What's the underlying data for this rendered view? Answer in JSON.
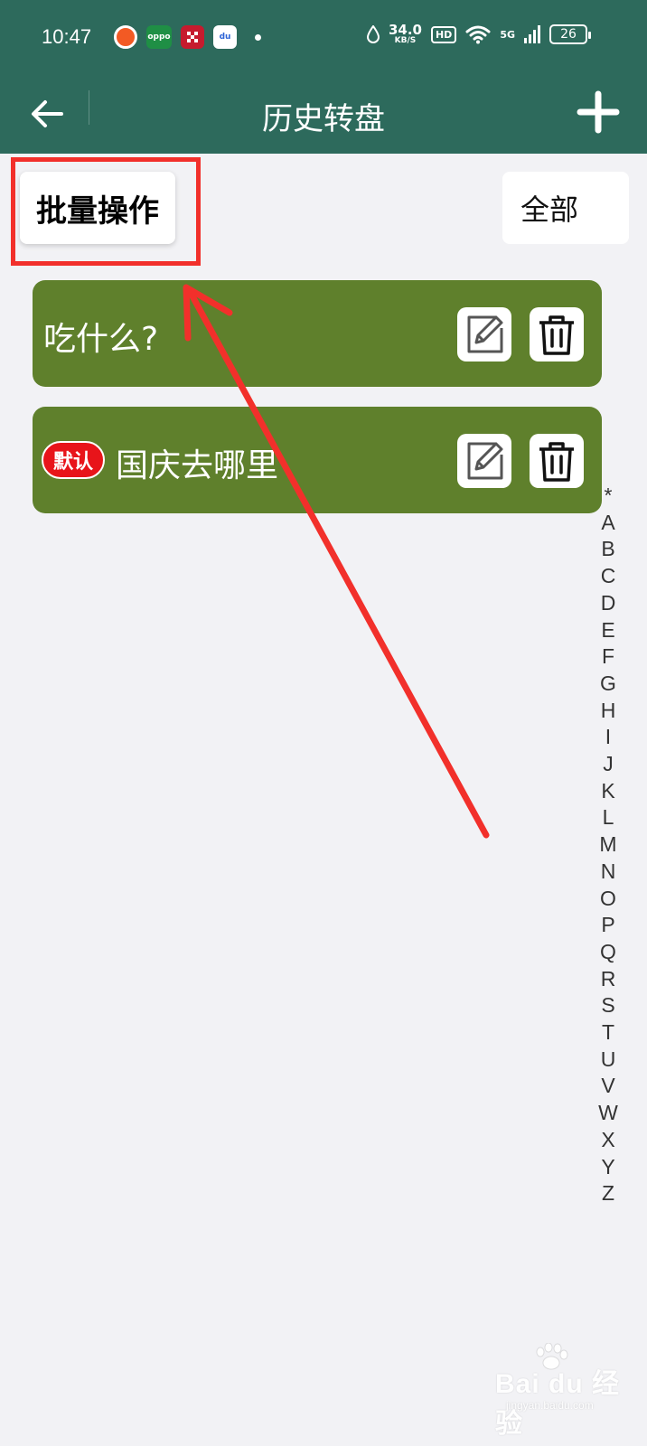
{
  "status_bar": {
    "time": "10:47",
    "notifications": [
      {
        "icon": "taobao-icon",
        "label": ""
      },
      {
        "icon": "oppo-icon",
        "label": "oppo"
      },
      {
        "icon": "checker-app-icon",
        "label": ""
      },
      {
        "icon": "baidu-icon",
        "label": "du"
      }
    ],
    "net_speed": "34.0",
    "net_speed_unit": "KB/S",
    "hd": "HD",
    "network": "5G",
    "battery": "26"
  },
  "app_bar": {
    "title": "历史转盘",
    "back_icon": "arrow-left-icon",
    "add_icon": "plus-icon"
  },
  "toolbar": {
    "batch_label": "批量操作",
    "filter_value": "全部"
  },
  "wheels": [
    {
      "title": "吃什么?",
      "is_default": false
    },
    {
      "title": "国庆去哪里",
      "is_default": true,
      "default_badge": "默认"
    }
  ],
  "alphabet_index": [
    "*",
    "A",
    "B",
    "C",
    "D",
    "E",
    "F",
    "G",
    "H",
    "I",
    "J",
    "K",
    "L",
    "M",
    "N",
    "O",
    "P",
    "Q",
    "R",
    "S",
    "T",
    "U",
    "V",
    "W",
    "X",
    "Y",
    "Z"
  ],
  "watermark": {
    "main": "Bai du 经验",
    "sub": "jingyan.baidu.com"
  },
  "colors": {
    "header": "#2d6a5c",
    "card": "#5f802c",
    "highlight": "#f2302b",
    "badge": "#e8141a",
    "background": "#f2f2f5"
  }
}
